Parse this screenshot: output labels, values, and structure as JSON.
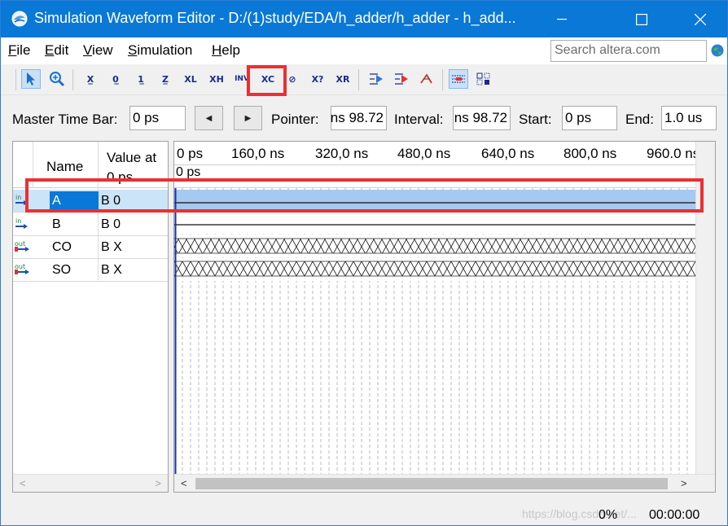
{
  "window": {
    "title": "Simulation Waveform Editor - D:/(1)study/EDA/h_adder/h_adder - h_add...",
    "accent": "#0a78d7"
  },
  "menu": {
    "items": [
      {
        "key": "file",
        "label": "File",
        "mnemonic": "F",
        "rest": "ile"
      },
      {
        "key": "edit",
        "label": "Edit",
        "mnemonic": "E",
        "rest": "dit"
      },
      {
        "key": "view",
        "label": "View",
        "mnemonic": "V",
        "rest": "iew"
      },
      {
        "key": "simulation",
        "label": "Simulation",
        "mnemonic": "S",
        "rest": "imulation"
      },
      {
        "key": "help",
        "label": "Help",
        "mnemonic": "H",
        "rest": "elp"
      }
    ],
    "search_placeholder": "Search altera.com"
  },
  "toolbar": {
    "buttons": [
      {
        "name": "selection-tool-icon",
        "glyph": "➤",
        "active": true
      },
      {
        "name": "zoom-tool-icon",
        "glyph": "🔍"
      },
      {
        "name": "forcing-unknown-icon",
        "glyph": "X̲"
      },
      {
        "name": "forcing-low-icon",
        "glyph": "0"
      },
      {
        "name": "forcing-high-icon",
        "glyph": "1"
      },
      {
        "name": "high-impedance-icon",
        "glyph": "Z"
      },
      {
        "name": "weak-low-icon",
        "glyph": "XL"
      },
      {
        "name": "weak-high-icon",
        "glyph": "XH"
      },
      {
        "name": "invert-icon",
        "glyph": "INV"
      },
      {
        "name": "count-value-icon",
        "glyph": "XC"
      },
      {
        "name": "overwrite-clock-icon",
        "glyph": "⊘"
      },
      {
        "name": "arbitrary-value-icon",
        "glyph": "X?"
      },
      {
        "name": "random-value-icon",
        "glyph": "XR"
      },
      {
        "name": "run-functional-simulation-icon",
        "glyph": "▶"
      },
      {
        "name": "run-timing-simulation-icon",
        "glyph": "▶"
      },
      {
        "name": "generate-netlist-icon",
        "glyph": "↯"
      },
      {
        "name": "snap-to-grid-icon",
        "glyph": "▦",
        "active": true
      },
      {
        "name": "grouping-icon",
        "glyph": "▣"
      }
    ]
  },
  "timebar": {
    "master_label": "Master Time Bar:",
    "master_value": "0 ps",
    "pointer_label": "Pointer:",
    "pointer_value": "98.72 ns",
    "interval_label": "Interval:",
    "interval_value": "98.72 ns",
    "start_label": "Start:",
    "start_value": "0 ps",
    "end_label": "End:",
    "end_value": "1.0 us"
  },
  "signals": {
    "header_name": "Name",
    "header_value": "Value at\n0 ps",
    "rows": [
      {
        "name": "A",
        "value": "B 0",
        "dir": "in",
        "selected": true,
        "wave": "low"
      },
      {
        "name": "B",
        "value": "B 0",
        "dir": "in",
        "wave": "low"
      },
      {
        "name": "CO",
        "value": "B X",
        "dir": "out",
        "wave": "unknown"
      },
      {
        "name": "SO",
        "value": "B X",
        "dir": "out",
        "wave": "unknown"
      }
    ]
  },
  "waveform": {
    "ruler": [
      "0 ps",
      "160,0 ns",
      "320,0 ns",
      "480,0 ns",
      "640,0 ns",
      "800,0 ns",
      "960.0 ns"
    ],
    "master_marker": "0 ps"
  },
  "status": {
    "progress": "0%",
    "elapsed": "00:00:00",
    "watermark": "https://blog.csdn.net/..."
  }
}
